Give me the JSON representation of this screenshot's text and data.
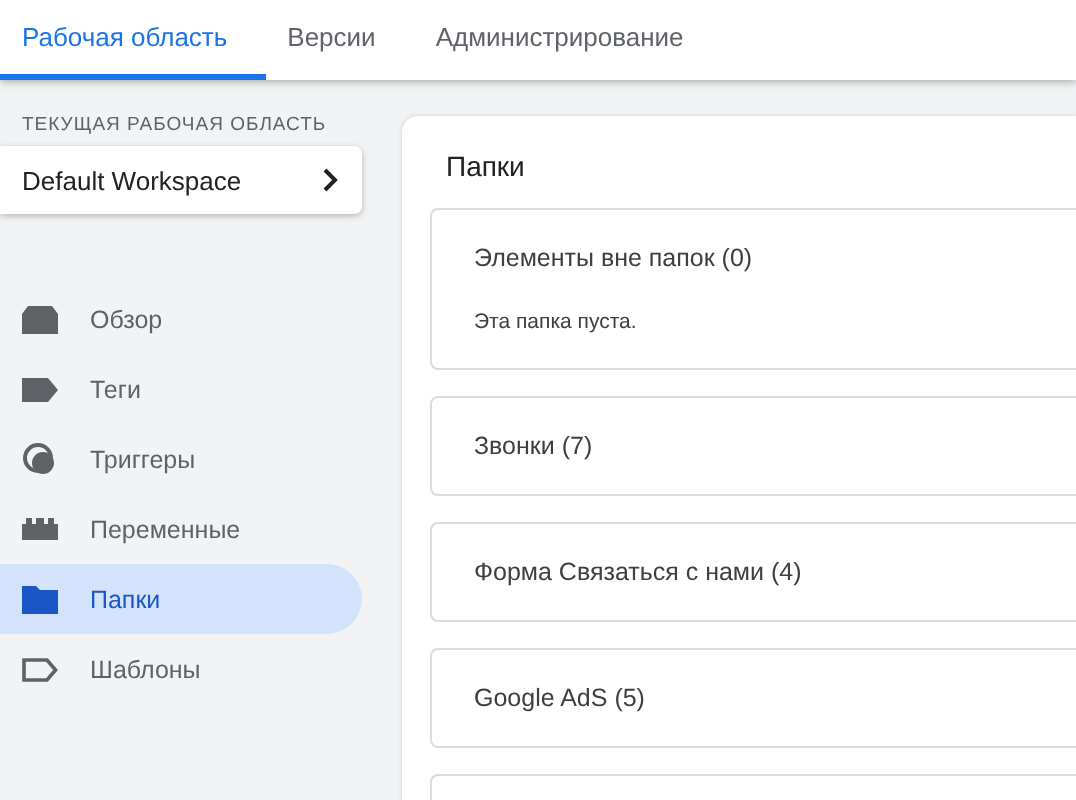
{
  "tabs": [
    {
      "label": "Рабочая область",
      "selected": true
    },
    {
      "label": "Версии",
      "selected": false
    },
    {
      "label": "Администрирование",
      "selected": false
    }
  ],
  "sidebar": {
    "workspace_label": "ТЕКУЩАЯ РАБОЧАЯ ОБЛАСТЬ",
    "workspace": "Default Workspace",
    "items": [
      {
        "kind": "overview",
        "label": "Обзор",
        "selected": false
      },
      {
        "kind": "tags",
        "label": "Теги",
        "selected": false
      },
      {
        "kind": "triggers",
        "label": "Триггеры",
        "selected": false
      },
      {
        "kind": "variables",
        "label": "Переменные",
        "selected": false
      },
      {
        "kind": "folders",
        "label": "Папки",
        "selected": true
      },
      {
        "kind": "templates",
        "label": "Шаблоны",
        "selected": false
      }
    ]
  },
  "main": {
    "title": "Папки",
    "folders": [
      {
        "title": "Элементы вне папок (0)",
        "note": "Эта папка пуста."
      },
      {
        "title": "Звонки (7)"
      },
      {
        "title": "Форма Связаться с нами (4)"
      },
      {
        "title": "Google AdS (5)"
      }
    ]
  }
}
